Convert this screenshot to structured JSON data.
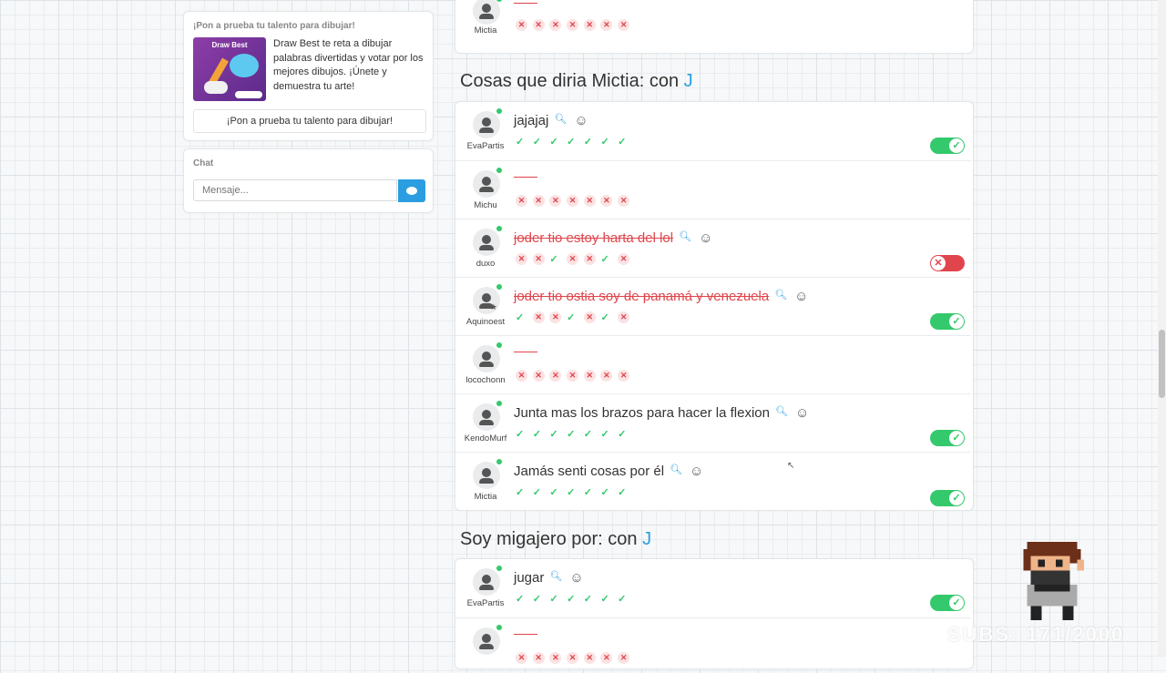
{
  "sidebar": {
    "ad": {
      "title": "¡Pon a prueba tu talento para dibujar!",
      "image_label": "Draw Best",
      "description": "Draw Best te reta a dibujar palabras divertidas y votar por los mejores dibujos. ¡Únete y demuestra tu arte!",
      "button_label": "¡Pon a prueba tu talento para dibujar!"
    },
    "chat": {
      "title": "Chat",
      "placeholder": "Mensaje..."
    }
  },
  "top_row": {
    "user": "Mictia",
    "votes": [
      "no",
      "no",
      "no",
      "no",
      "no",
      "no",
      "no"
    ]
  },
  "sections": [
    {
      "title": "Cosas que diria Mictia: con",
      "letter": "J",
      "rows": [
        {
          "user": "EvaPartis",
          "answer": "jajajaj",
          "struck": false,
          "votes": [
            "ok",
            "ok",
            "ok",
            "ok",
            "ok",
            "ok",
            "ok"
          ],
          "toggle": "on"
        },
        {
          "user": "Michu",
          "answer": "",
          "struck": false,
          "votes": [
            "no",
            "no",
            "no",
            "no",
            "no",
            "no",
            "no"
          ],
          "toggle": null
        },
        {
          "user": "duxo",
          "answer": "joder tio estoy harta del lol",
          "struck": true,
          "votes": [
            "no",
            "no",
            "ok",
            "no",
            "no",
            "ok",
            "no"
          ],
          "toggle": "off"
        },
        {
          "user": "Aquinoest",
          "answer": "joder tio ostia soy de panamá y venezuela",
          "struck": true,
          "votes": [
            "ok",
            "no",
            "no",
            "ok",
            "no",
            "ok",
            "no"
          ],
          "toggle": "on"
        },
        {
          "user": "locochonn",
          "answer": "",
          "struck": false,
          "votes": [
            "no",
            "no",
            "no",
            "no",
            "no",
            "no",
            "no"
          ],
          "toggle": null
        },
        {
          "user": "KendoMurf",
          "answer": "Junta mas los brazos para hacer la flexion",
          "struck": false,
          "votes": [
            "ok",
            "ok",
            "ok",
            "ok",
            "ok",
            "ok",
            "ok"
          ],
          "toggle": "on"
        },
        {
          "user": "Mictia",
          "answer": "Jamás senti cosas por él",
          "struck": false,
          "votes": [
            "ok",
            "ok",
            "ok",
            "ok",
            "ok",
            "ok",
            "ok"
          ],
          "toggle": "on"
        }
      ]
    },
    {
      "title": "Soy migajero por: con",
      "letter": "J",
      "rows": [
        {
          "user": "EvaPartis",
          "answer": "jugar",
          "struck": false,
          "votes": [
            "ok",
            "ok",
            "ok",
            "ok",
            "ok",
            "ok",
            "ok"
          ],
          "toggle": "on"
        },
        {
          "user": "",
          "answer": "",
          "struck": false,
          "votes": [
            "no",
            "no",
            "no",
            "no",
            "no",
            "no",
            "no"
          ],
          "toggle": null
        }
      ]
    }
  ],
  "overlay": {
    "subs_text": "SUBS: 171/2000"
  },
  "colors": {
    "accent": "#2a9ee0",
    "ok": "#34c96c",
    "no": "#e0454c"
  },
  "icons": {
    "search": "search-icon",
    "emoji_add": "add-reaction-icon",
    "user": "user-avatar-icon",
    "send": "chat-bubble-icon"
  }
}
